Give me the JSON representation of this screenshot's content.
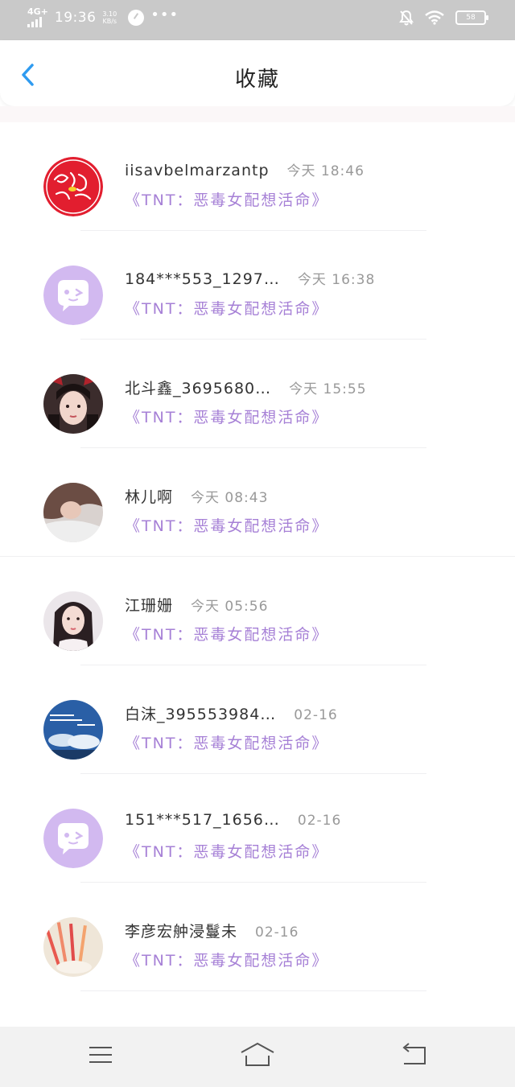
{
  "status_bar": {
    "network": "4G+",
    "time": "19:36",
    "speed_value": "3.10",
    "speed_unit": "KB/s",
    "battery": "58"
  },
  "header": {
    "title": "收藏"
  },
  "favorites": [
    {
      "name": "iisavbelmarzantp",
      "time": "今天 18:46",
      "book": "《TNT：恶毒女配想活命》"
    },
    {
      "name": "184***553_1297…",
      "time": "今天 16:38",
      "book": "《TNT：恶毒女配想活命》"
    },
    {
      "name": "北斗鑫_3695680…",
      "time": "今天 15:55",
      "book": "《TNT：恶毒女配想活命》"
    },
    {
      "name": "林儿啊",
      "time": "今天 08:43",
      "book": "《TNT：恶毒女配想活命》"
    },
    {
      "name": "江珊姗",
      "time": "今天 05:56",
      "book": "《TNT：恶毒女配想活命》"
    },
    {
      "name": "白沫_395553984…",
      "time": "02-16",
      "book": "《TNT：恶毒女配想活命》"
    },
    {
      "name": "151***517_1656…",
      "time": "02-16",
      "book": "《TNT：恶毒女配想活命》"
    },
    {
      "name": "李彦宏舯浸鬘未",
      "time": "02-16",
      "book": "《TNT：恶毒女配想活命》"
    }
  ],
  "colors": {
    "accent": "#2f9bf0",
    "book_title": "#a680d6",
    "default_avatar": "#d2b9f0"
  },
  "nav": {
    "menu_icon": "menu-icon",
    "home_icon": "home-icon",
    "back_icon": "return-icon"
  }
}
